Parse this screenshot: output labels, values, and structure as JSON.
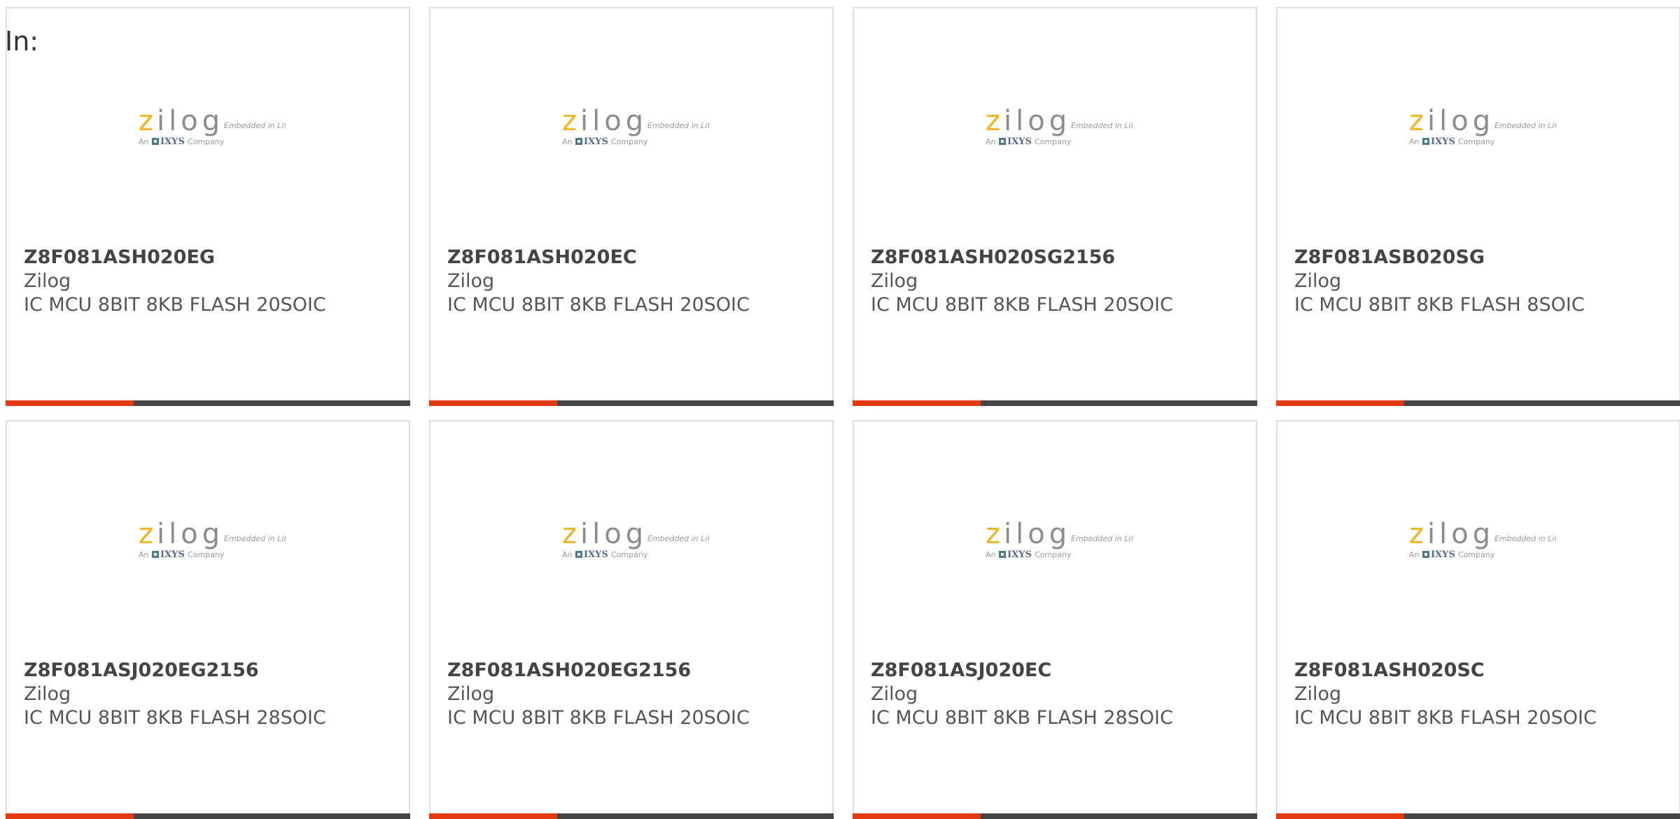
{
  "header": {
    "in_label": "In:"
  },
  "colors": {
    "accent": "#e33a12",
    "bar_dark": "#454545",
    "logo_z": "#f2b51e",
    "logo_gray": "#8c8c8c"
  },
  "logo": {
    "brand": "zilog",
    "tagline": "Embedded in Life",
    "company": "An IXYS Company"
  },
  "products": [
    {
      "part_number": "Z8F081ASH020EG",
      "manufacturer": "Zilog",
      "description": "IC MCU 8BIT 8KB FLASH 20SOIC"
    },
    {
      "part_number": "Z8F081ASH020EC",
      "manufacturer": "Zilog",
      "description": "IC MCU 8BIT 8KB FLASH 20SOIC"
    },
    {
      "part_number": "Z8F081ASH020SG2156",
      "manufacturer": "Zilog",
      "description": "IC MCU 8BIT 8KB FLASH 20SOIC"
    },
    {
      "part_number": "Z8F081ASB020SG",
      "manufacturer": "Zilog",
      "description": "IC MCU 8BIT 8KB FLASH 8SOIC"
    },
    {
      "part_number": "Z8F081ASJ020EG2156",
      "manufacturer": "Zilog",
      "description": "IC MCU 8BIT 8KB FLASH 28SOIC"
    },
    {
      "part_number": "Z8F081ASH020EG2156",
      "manufacturer": "Zilog",
      "description": "IC MCU 8BIT 8KB FLASH 20SOIC"
    },
    {
      "part_number": "Z8F081ASJ020EC",
      "manufacturer": "Zilog",
      "description": "IC MCU 8BIT 8KB FLASH 28SOIC"
    },
    {
      "part_number": "Z8F081ASH020SC",
      "manufacturer": "Zilog",
      "description": "IC MCU 8BIT 8KB FLASH 20SOIC"
    }
  ]
}
